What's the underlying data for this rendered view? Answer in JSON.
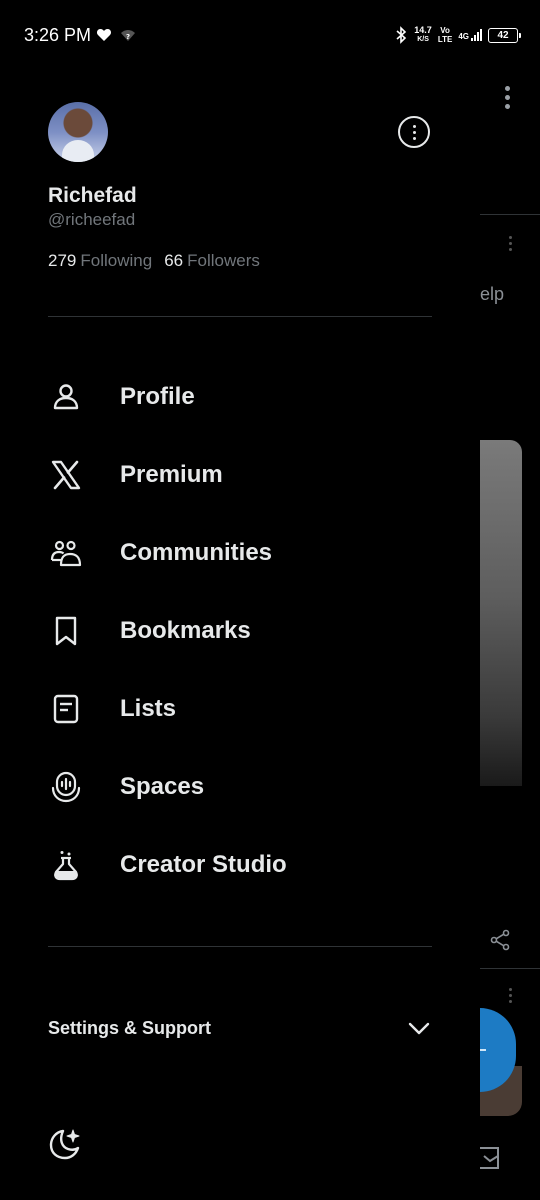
{
  "status_bar": {
    "time": "3:26 PM",
    "net_speed_value": "14.7",
    "net_speed_unit": "K/S",
    "volte_top": "Vo",
    "volte_bottom": "LTE",
    "network": "4G",
    "battery": "42"
  },
  "profile": {
    "display_name": "Richefad",
    "handle": "@richeefad",
    "following_count": "279",
    "following_label": "Following",
    "followers_count": "66",
    "followers_label": "Followers"
  },
  "menu": {
    "items": [
      {
        "label": "Profile",
        "icon": "person-icon"
      },
      {
        "label": "Premium",
        "icon": "x-logo-icon"
      },
      {
        "label": "Communities",
        "icon": "communities-icon"
      },
      {
        "label": "Bookmarks",
        "icon": "bookmark-icon"
      },
      {
        "label": "Lists",
        "icon": "list-icon"
      },
      {
        "label": "Spaces",
        "icon": "spaces-icon"
      },
      {
        "label": "Creator Studio",
        "icon": "flask-icon"
      }
    ]
  },
  "settings": {
    "label": "Settings & Support"
  },
  "background": {
    "help_fragment": "elp"
  },
  "colors": {
    "background": "#000000",
    "text_primary": "#e7e9ea",
    "text_secondary": "#71767b",
    "divider": "#2f3336",
    "fab": "#1d7bc4"
  }
}
